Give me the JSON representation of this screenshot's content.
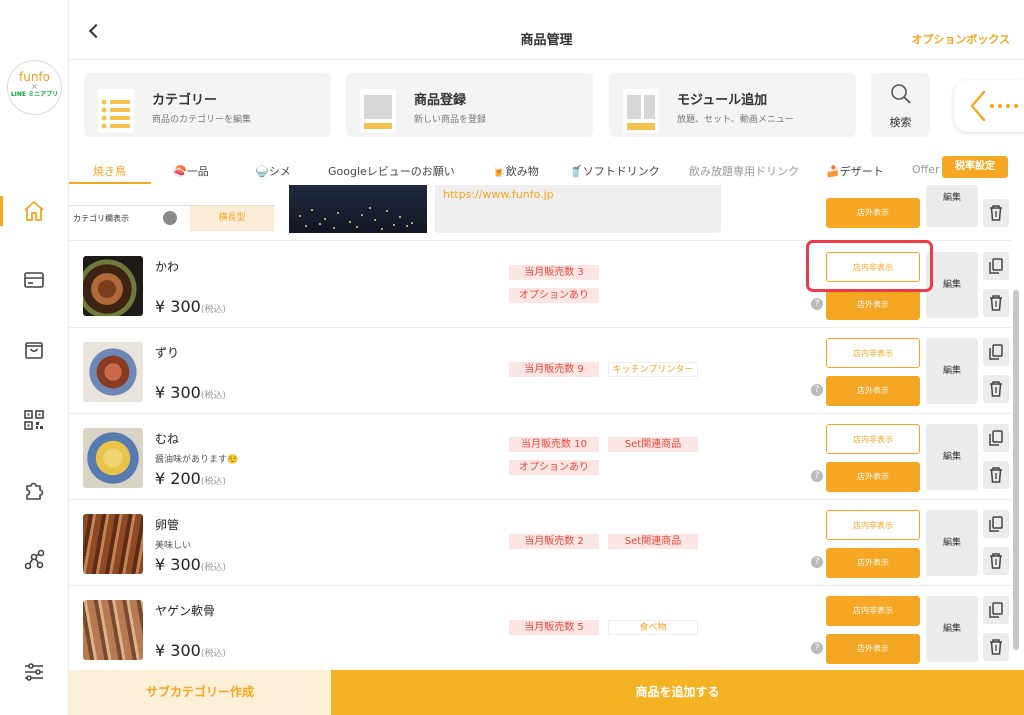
{
  "logo": {
    "line1": "funfo",
    "line2": "×",
    "line3": "LINE ミニアプリ"
  },
  "header": {
    "title": "商品管理",
    "option_link": "オプションボックス"
  },
  "quick": [
    {
      "title": "カテゴリー",
      "subtitle": "商品のカテゴリーを編集"
    },
    {
      "title": "商品登録",
      "subtitle": "新しい商品を登録"
    },
    {
      "title": "モジュール追加",
      "subtitle": "放題、セット、動画メニュー"
    }
  ],
  "search_label": "検索",
  "tabs": [
    "焼き鳥",
    "🍣一品",
    "🍚シメ",
    "Googleレビューのお願い",
    "🍺飲み物",
    "🥤ソフトドリンク",
    "飲み放題専用ドリンク",
    "🍰デザート",
    "Offer"
  ],
  "tax_button": "税率設定",
  "category_panel": {
    "toggle_label": "カテゴリ欄表示",
    "layout_chip": "横長型",
    "url": "https://www.funfo.jp",
    "hide_label": "店内非表示",
    "show_label": "店外表示",
    "edit_label": "編集"
  },
  "products": [
    {
      "name": "かわ",
      "desc": "",
      "price": "¥ 300",
      "tax": "(税込)",
      "badges": [
        "当月販売数 3",
        "オプションあり"
      ],
      "badge2": "",
      "hide": "店内非表示",
      "show": "店外表示",
      "edit": "編集"
    },
    {
      "name": "ずり",
      "desc": "",
      "price": "¥ 300",
      "tax": "(税込)",
      "badges": [
        "当月販売数 9"
      ],
      "badge2": "キッチンプリンター",
      "hide": "店内非表示",
      "show": "店外表示",
      "edit": "編集"
    },
    {
      "name": "むね",
      "desc": "醤油味があります☺️",
      "price": "¥ 200",
      "tax": "(税込)",
      "badges": [
        "当月販売数 10",
        "オプションあり"
      ],
      "badge2": "Set関連商品",
      "hide": "店内非表示",
      "show": "店外表示",
      "edit": "編集"
    },
    {
      "name": "卵管",
      "desc": "美味しい",
      "price": "¥ 300",
      "tax": "(税込)",
      "badges": [
        "当月販売数 2"
      ],
      "badge2": "Set関連商品",
      "hide": "店内非表示",
      "show": "店外表示",
      "edit": "編集"
    },
    {
      "name": "ヤゲン軟骨",
      "desc": "",
      "price": "¥ 300",
      "tax": "(税込)",
      "badges": [
        "当月販売数 5"
      ],
      "badge2": "食べ物",
      "hide": "店内非表示",
      "show": "店外表示",
      "edit": "編集"
    }
  ],
  "help_mark": "?",
  "footer": {
    "sub_category": "サブカテゴリー作成",
    "add_product": "商品を追加する"
  },
  "colors": {
    "accent": "#f5a623",
    "badge_text": "#e8473a",
    "highlight": "#ee3a4a"
  }
}
